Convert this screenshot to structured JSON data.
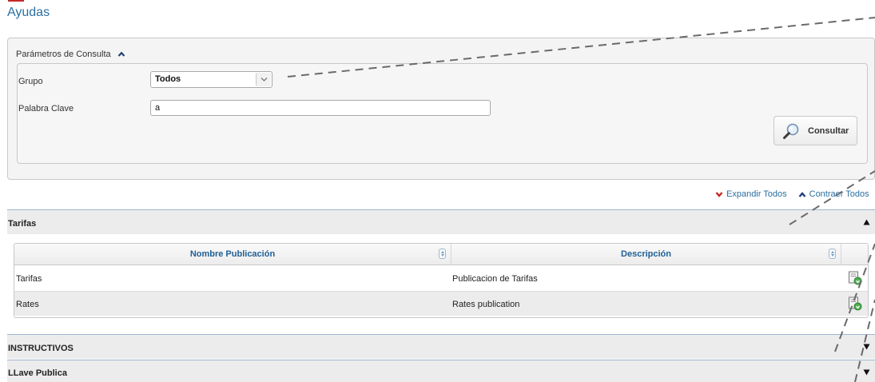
{
  "page": {
    "title": "Ayudas"
  },
  "params": {
    "header": "Parámetros de Consulta",
    "grupo_label": "Grupo",
    "grupo_value": "Todos",
    "palabra_label": "Palabra Clave",
    "palabra_value": "a",
    "consult_label": "Consultar"
  },
  "toggles": {
    "expand": "Expandir Todos",
    "collapse": "Contraer Todos"
  },
  "sections": {
    "tarifas": {
      "title": "Tarifas",
      "columns": [
        "Nombre Publicación",
        "Descripción"
      ],
      "rows": [
        {
          "nombre": "Tarifas",
          "descripcion": "Publicacion de Tarifas"
        },
        {
          "nombre": "Rates",
          "descripcion": "Rates publication"
        }
      ]
    },
    "instructivos": {
      "title": "INSTRUCTIVOS"
    },
    "llave": {
      "title": "LLave Publica"
    }
  },
  "colors": {
    "accent": "#2a6fa0",
    "header_text": "#1f5f95",
    "expand_icon": "#c62828",
    "collapse_icon": "#1f3f7a"
  },
  "icons": {
    "params_toggle": "chevron-up-icon",
    "consult": "magnifier-icon",
    "expand": "chevron-down-icon",
    "collapse": "chevron-up-icon",
    "sort": "sort-icon",
    "download": "document-download-icon",
    "section_open": "triangle-up-icon",
    "section_closed": "triangle-down-icon"
  }
}
